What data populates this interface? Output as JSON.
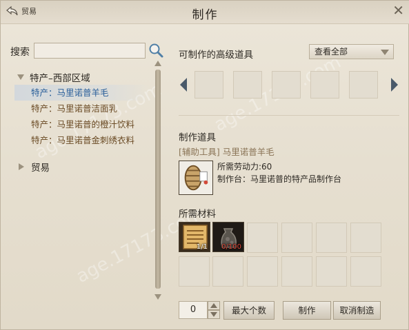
{
  "window": {
    "title": "制作",
    "back_label": "贸易"
  },
  "search": {
    "label": "搜索",
    "value": ""
  },
  "tree": {
    "category_open": "特产–西部区域",
    "items": [
      {
        "label": "特产：马里诺普羊毛",
        "selected": true
      },
      {
        "label": "特产：马里诺普洁面乳",
        "selected": false
      },
      {
        "label": "特产：马里诺普的橙汁饮料",
        "selected": false
      },
      {
        "label": "特产：马里诺普金刺绣衣料",
        "selected": false
      }
    ],
    "category_closed": "贸易"
  },
  "advanced": {
    "title": "可制作的高级道具",
    "filter_value": "查看全部"
  },
  "tool": {
    "section_title": "制作道具",
    "name": "[辅助工具] 马里诺普羊毛",
    "labor": "所需劳动力:60",
    "station": "制作台：马里诺普的特产品制作台"
  },
  "materials": {
    "section_title": "所需材料",
    "items": [
      {
        "icon": "document-icon",
        "count": "1/1"
      },
      {
        "icon": "wool-bag-icon",
        "count": "0/100"
      }
    ]
  },
  "controls": {
    "quantity": "0",
    "max_label": "最大个数",
    "craft_label": "制作",
    "cancel_label": "取消制造"
  },
  "colors": {
    "selected_text": "#2a5f9a",
    "item_text": "#6a4a24",
    "insufficient": "#e04a3a"
  },
  "watermark": "age.17173.com"
}
